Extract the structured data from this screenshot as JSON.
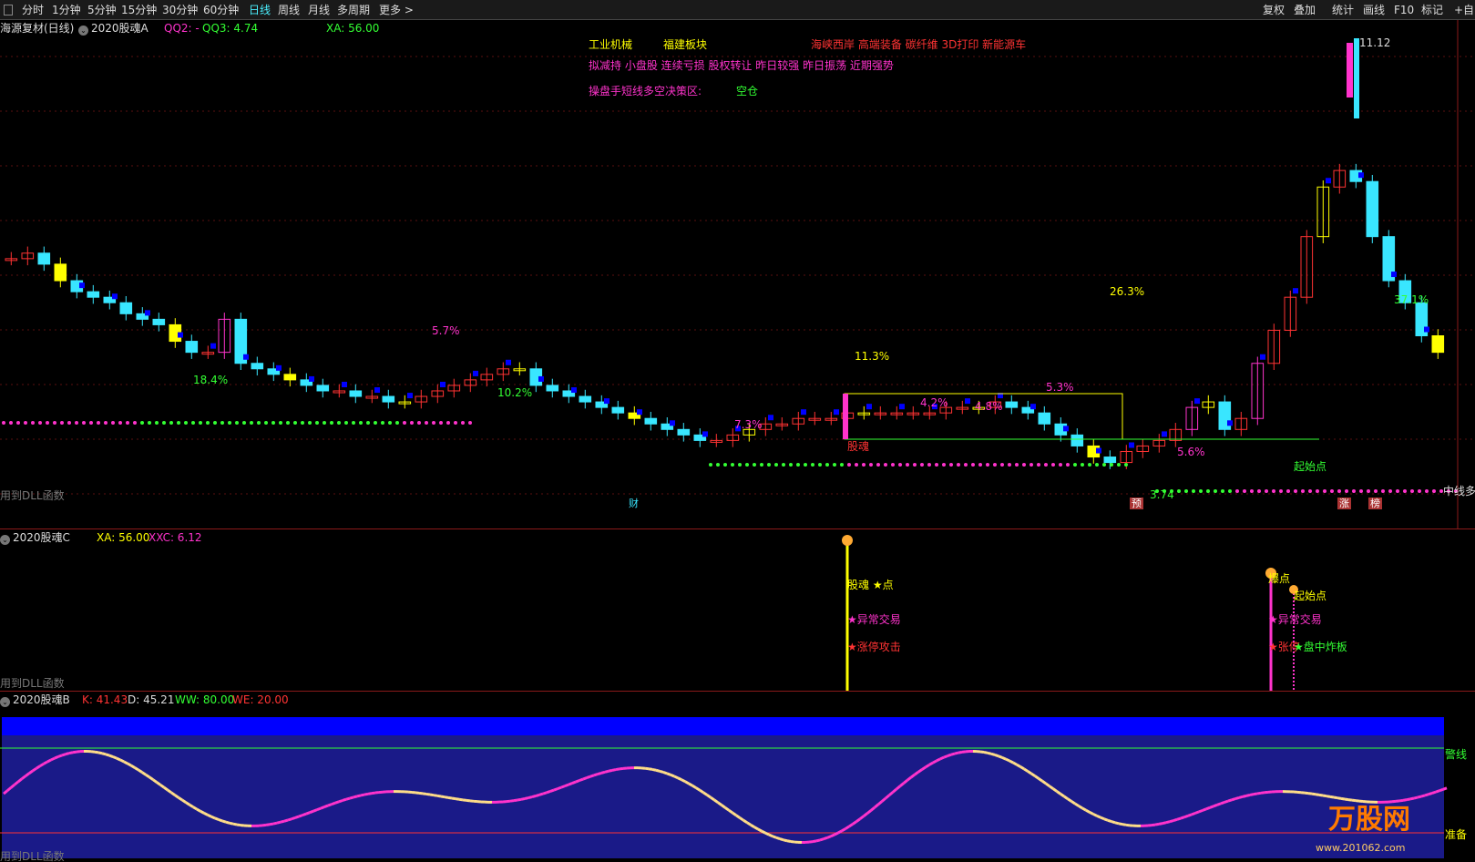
{
  "toolbar": {
    "periods": [
      "分时",
      "1分钟",
      "5分钟",
      "15分钟",
      "30分钟",
      "60分钟",
      "日线",
      "周线",
      "月线",
      "多周期",
      "更多 >"
    ],
    "active": "日线",
    "right": [
      "复权",
      "叠加",
      "统计",
      "画线",
      "F10",
      "标记",
      "+自"
    ]
  },
  "main": {
    "stock": "海源复材(日线)",
    "indicator": "2020股魂A",
    "qq2": "QQ2: -",
    "qq3": "QQ3: 4.74",
    "xa": "XA: 56.00",
    "sector1": "工业机械",
    "sector2": "福建板块",
    "concepts": "海峡西岸 高端装备 碳纤维 3D打印 新能源车",
    "tags": "拟减持 小盘股 连续亏损 股权转让 昨日较强 昨日振荡 近期强势",
    "zone_label": "操盘手短线多空决策区:",
    "zone_value": "空仓",
    "max_label": "11.12",
    "min_label": "3.74",
    "pct": [
      "18.4%",
      "5.7%",
      "10.2%",
      "7.3%",
      "11.3%",
      "4.2%",
      "4.8%",
      "5.3%",
      "26.3%",
      "5.6%",
      "37.1%"
    ],
    "guhun": "股魂",
    "start_point": "起始点",
    "dll": "用到DLL函数",
    "midline": "中线多",
    "badge_cai": "财",
    "badge_yu": "预",
    "badge_zhang": "涨",
    "badge_bang": "榜"
  },
  "mid": {
    "indicator": "2020股魂C",
    "xa": "XA: 56.00",
    "xxc": "XXC: 6.12",
    "sig1_title": "股魂 ★点",
    "sig1_a": "★异常交易",
    "sig1_b": "★涨停攻击",
    "sig2_title": "爆点",
    "sig2_start": "起始点",
    "sig2_a": "★异常交易",
    "sig2_b": "★张停",
    "sig2_c": "★盘中炸板",
    "dll": "用到DLL函数"
  },
  "bottom": {
    "indicator": "2020股魂B",
    "k": "K: 41.43",
    "d": "D: 45.21",
    "ww": "WW: 80.00",
    "we": "WE: 20.00",
    "warn": "警线",
    "ready": "准备",
    "dll": "用到DLL函数",
    "watermark": "万股网",
    "watermark_url": "www.201062.com"
  },
  "colors": {
    "up": "#ff3333",
    "down": "#39e6ff",
    "yellow": "#ffff00",
    "magenta": "#ff33cc",
    "blue": "#0000ff",
    "green": "#33ff33",
    "band": "#1a1a88"
  },
  "chart_data": {
    "type": "candlestick",
    "ohlc_close_series": [
      7.6,
      7.7,
      7.5,
      7.2,
      7.0,
      6.9,
      6.8,
      6.6,
      6.5,
      6.4,
      6.1,
      5.9,
      5.9,
      6.5,
      5.7,
      5.6,
      5.5,
      5.4,
      5.3,
      5.2,
      5.2,
      5.1,
      5.1,
      5.0,
      5.0,
      5.1,
      5.2,
      5.3,
      5.4,
      5.5,
      5.6,
      5.6,
      5.3,
      5.2,
      5.1,
      5.0,
      4.9,
      4.8,
      4.7,
      4.6,
      4.5,
      4.4,
      4.3,
      4.3,
      4.4,
      4.5,
      4.6,
      4.6,
      4.7,
      4.7,
      4.7,
      4.8,
      4.8,
      4.8,
      4.8,
      4.8,
      4.8,
      4.9,
      4.9,
      4.9,
      5.0,
      4.9,
      4.8,
      4.6,
      4.4,
      4.2,
      4.0,
      3.9,
      4.1,
      4.2,
      4.3,
      4.5,
      4.9,
      5.0,
      4.5,
      4.7,
      5.7,
      6.3,
      6.9,
      8.0,
      8.9,
      9.2,
      9.0,
      8.0,
      7.2,
      6.8,
      6.2,
      5.9
    ]
  }
}
